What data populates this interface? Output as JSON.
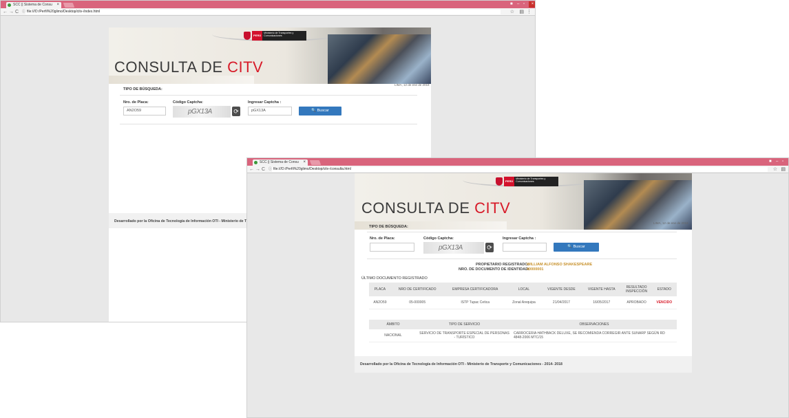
{
  "window1": {
    "tab_title": "SCC || Sistema de Consu",
    "url": "file:///D:/Perfil%20glimo/Desktop/citv-/index.html",
    "logo": {
      "peru": "PERÚ",
      "ministry": "Ministerio de Transportes y Comunicaciones"
    },
    "title_prefix": "CONSULTA DE ",
    "title_highlight": "CITV",
    "date": "LIMA, 12 de ene de 2018",
    "search_type_label": "TIPO DE BÚSQUEDA:",
    "placa_label": "Nro. de Placa:",
    "placa_value": "AN2O59",
    "captcha_label": "Código Captcha:",
    "captcha_text": "pGX13A",
    "ingresar_label": "Ingresar Captcha :",
    "ingresar_value": "pGX13A",
    "buscar": "Buscar",
    "footer": "Desarrollado por la Oficina de Tecnología de Información OTI - Ministerio de Transport"
  },
  "window2": {
    "tab_title": "SCC || Sistema de Consu",
    "url": "file:///D:/Perfil%20glimo/Desktop/citv-/consulta.html",
    "logo": {
      "peru": "PERÚ",
      "ministry": "Ministerio de Transportes y Comunicaciones"
    },
    "title_prefix": "CONSULTA DE ",
    "title_highlight": "CITV",
    "date": "LIMA, 12 de ene de 2018",
    "search_type_label": "TIPO DE BÚSQUEDA:",
    "placa_label": "Nro. de Placa:",
    "captcha_label": "Código Captcha:",
    "captcha_text": "pGX13A",
    "ingresar_label": "Ingresar Captcha :",
    "buscar": "Buscar",
    "owner_label": "PROPIETARIO REGISTRADO:",
    "owner_value": "WILLIAM ALFONSO SHAKESPEARE",
    "doc_label": "NRO. DE DOCUMENTO DE IDENTIDAD:",
    "doc_value": "40000001",
    "last_doc_label": "ÚLTIMO DOCUMENTO REGISTRADO",
    "table1": {
      "headers": [
        "PLACA",
        "NRO DE CERTIFICADO",
        "EMPRESA CERTIFICADORA",
        "LOCAL",
        "VIGENTE DESDE",
        "VIGENTE HASTA",
        "RESULTADO INSPECCIÓN",
        "ESTADO"
      ],
      "row": [
        "AN2O59",
        "05-000005",
        "ISTP Tupac Cetica",
        "Zonal Arequipa",
        "21/04/2017",
        "16/05/2017",
        "APROBADO",
        "VENCIDO"
      ]
    },
    "table2": {
      "headers": [
        "ÁMBITO",
        "TIPO DE SERVICIO",
        "OBSERVACIONES"
      ],
      "row": [
        "NACIONAL",
        "SERVICIO DE TRANSPORTE ESPECIAL DE PERSONAS - TURÍSTICO",
        "CARROCERIA HATHBACK DELUXE, SE RECOMIENDA CORREGIR ANTE SUNARP SEGÚN RD 4848-2006 MTC/15"
      ]
    },
    "footer": "Desarrollado por la Oficina de Tecnología de Información OTI - Ministerio de Transporte y Comunicaciones - 2014- 2018"
  },
  "colors": {
    "titlebar": "#d9647c",
    "accent_red": "#d71a28",
    "button_blue": "#3378bd",
    "owner_gold": "#c7902a"
  }
}
